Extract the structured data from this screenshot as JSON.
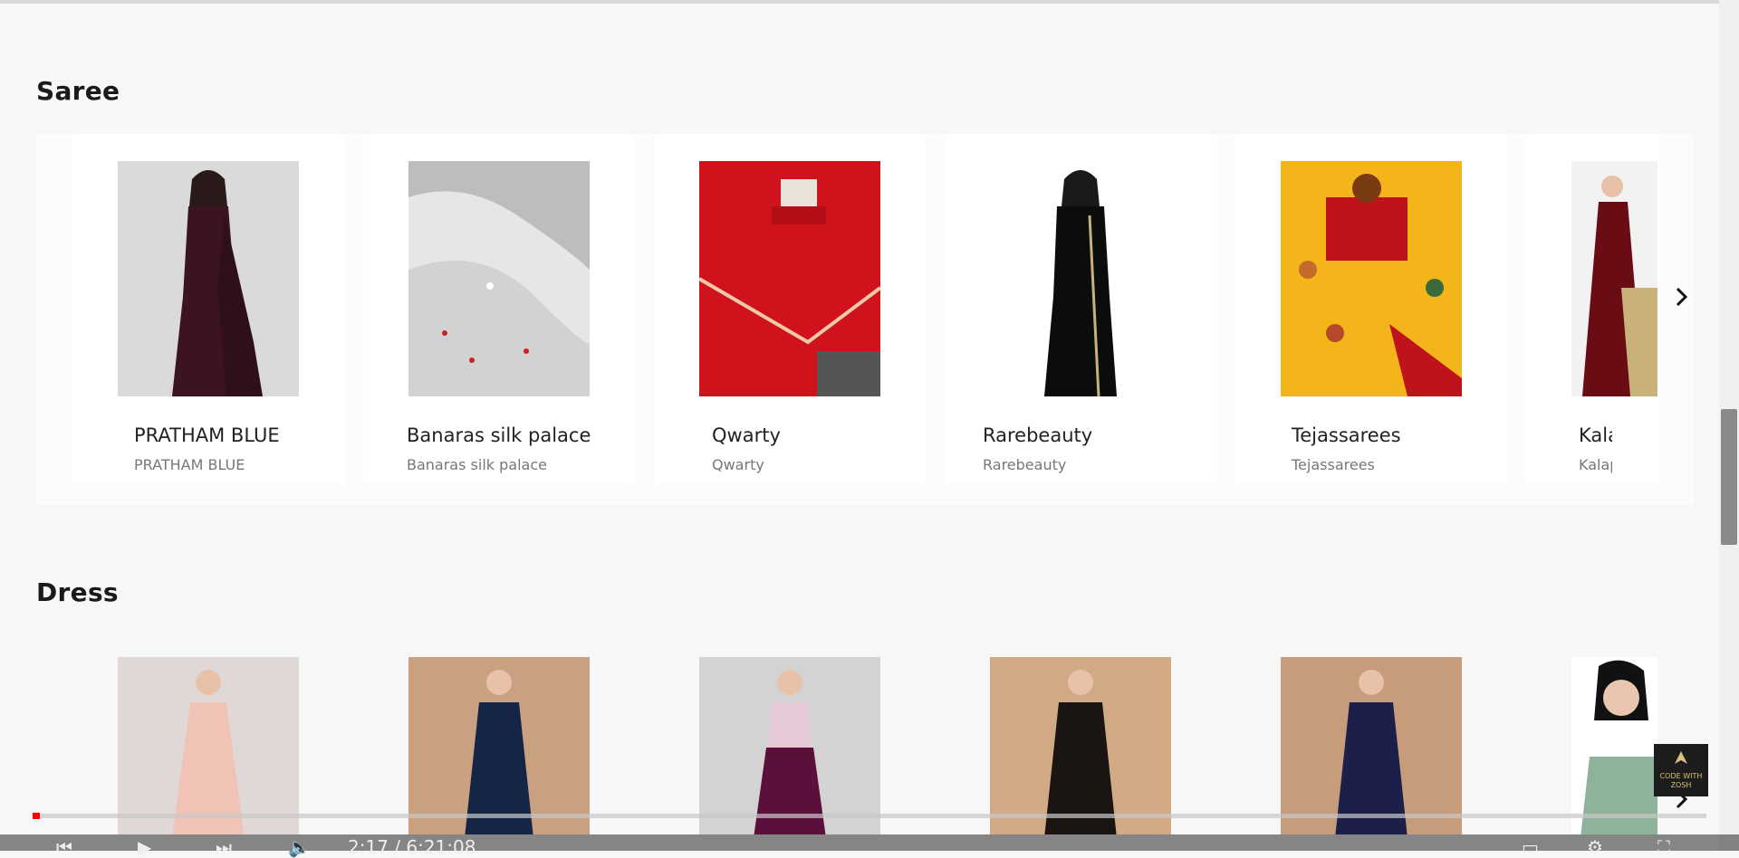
{
  "sections": [
    {
      "title": "Saree",
      "items": [
        {
          "title": "PRATHAM BLUE",
          "subtitle": "PRATHAM BLUE"
        },
        {
          "title": "Banaras silk palace",
          "subtitle": "Banaras silk palace"
        },
        {
          "title": "Qwarty",
          "subtitle": "Qwarty"
        },
        {
          "title": "Rarebeauty",
          "subtitle": "Rarebeauty"
        },
        {
          "title": "Tejassarees",
          "subtitle": "Tejassarees"
        },
        {
          "title": "Kalap",
          "subtitle": "Kalapu"
        }
      ]
    },
    {
      "title": "Dress"
    }
  ],
  "watermark": {
    "text": "CODE WITH ZOSH"
  },
  "video": {
    "time": "2:17 / 6:21:08",
    "progress": 0.004
  },
  "colors": {
    "accent": "#ff0000"
  }
}
